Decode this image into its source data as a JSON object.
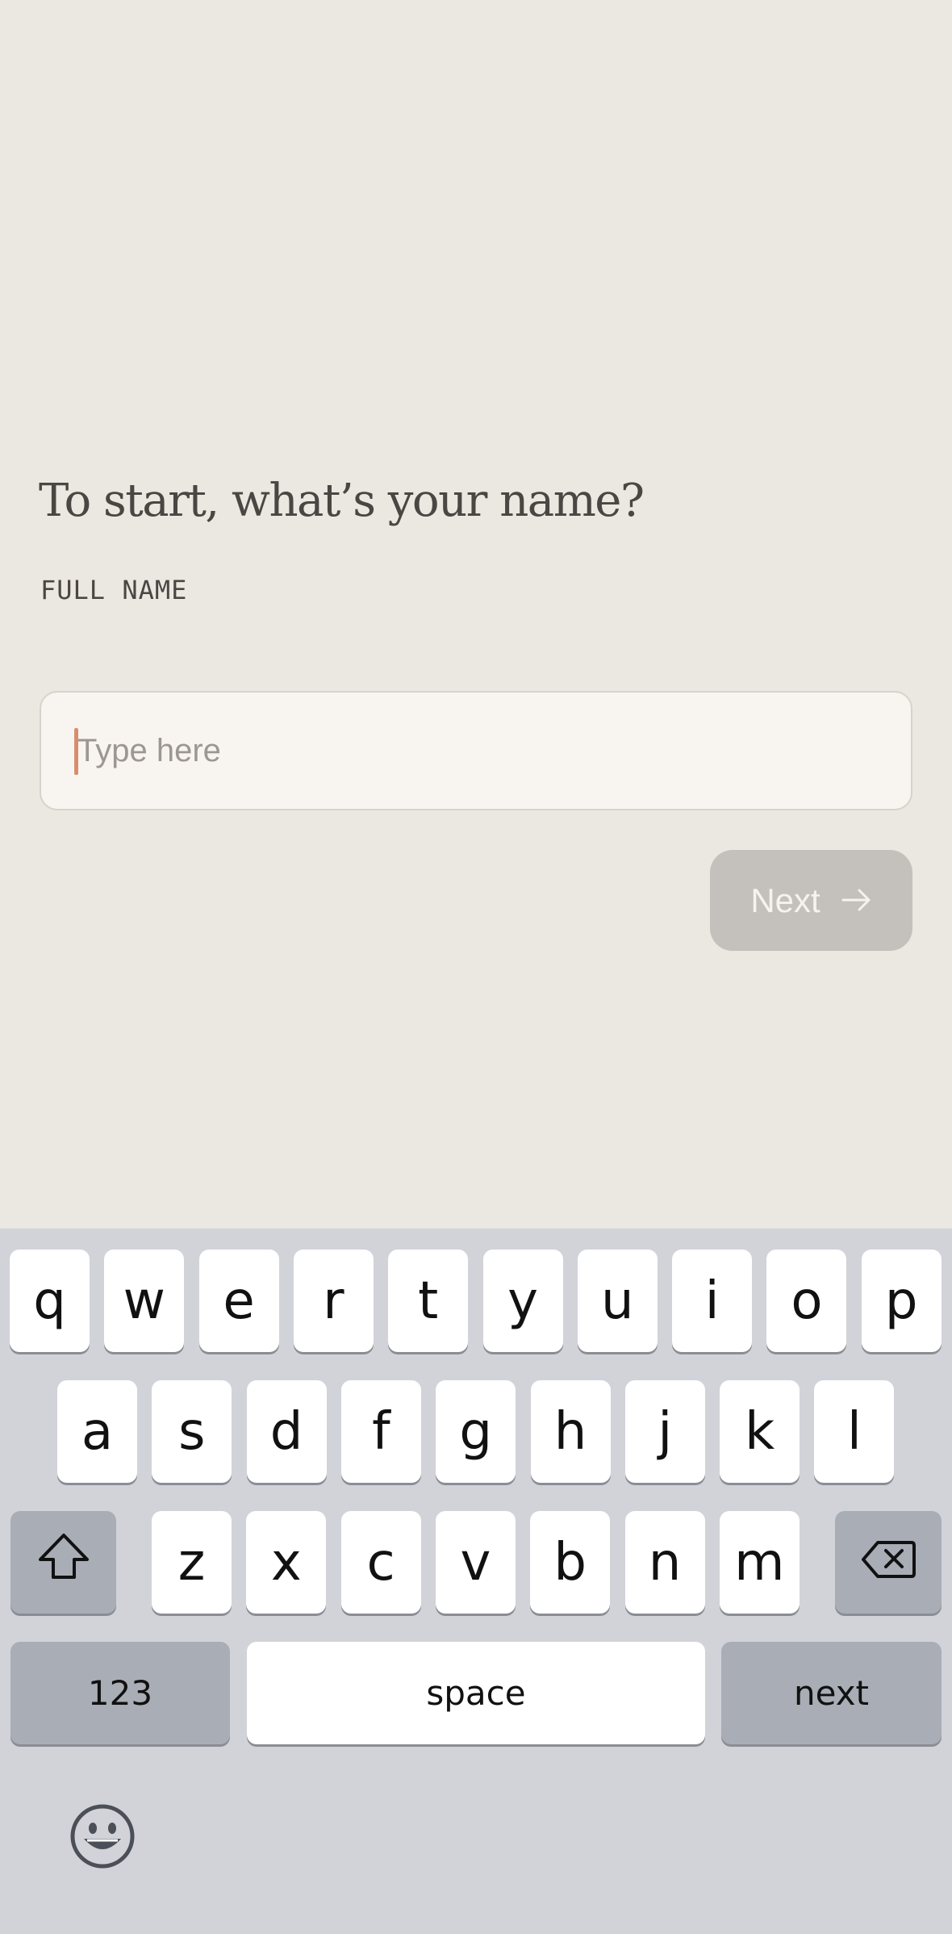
{
  "question": "To start, what’s your name?",
  "field_label": "FULL NAME",
  "name_input": {
    "value": "",
    "placeholder": "Type here"
  },
  "next_button": {
    "label": "Next",
    "icon": "arrow-right-icon"
  },
  "keyboard": {
    "row1": [
      "q",
      "w",
      "e",
      "r",
      "t",
      "y",
      "u",
      "i",
      "o",
      "p"
    ],
    "row2": [
      "a",
      "s",
      "d",
      "f",
      "g",
      "h",
      "j",
      "k",
      "l"
    ],
    "row3": [
      "z",
      "x",
      "c",
      "v",
      "b",
      "n",
      "m"
    ],
    "numbers_label": "123",
    "space_label": "space",
    "next_label": "next",
    "shift_icon": "shift-icon",
    "delete_icon": "backspace-icon",
    "emoji_icon": "emoji-icon"
  },
  "colors": {
    "background": "#ebe7e1",
    "caret": "#d58f6e",
    "button_disabled": "#c4c0bb",
    "keyboard_bg": "#d2d3d9"
  }
}
